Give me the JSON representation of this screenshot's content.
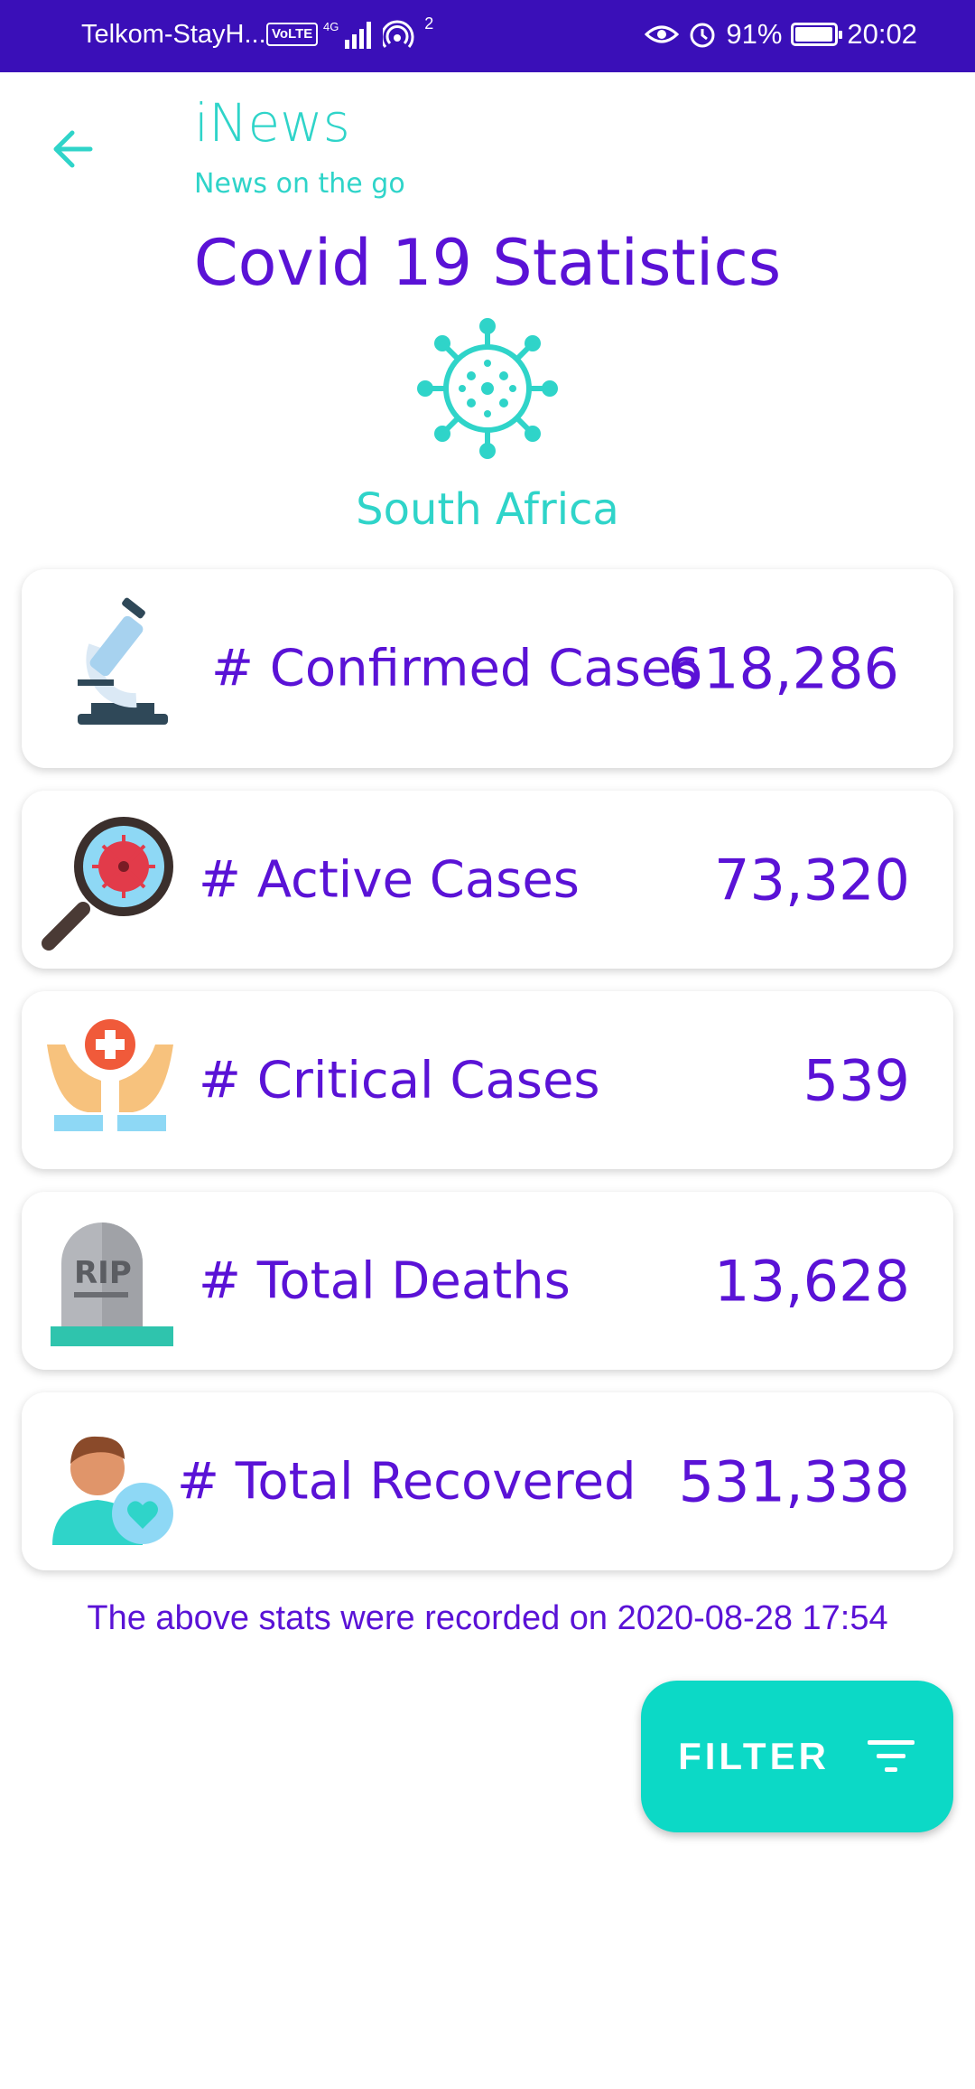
{
  "status_bar": {
    "carrier": "Telkom-StayH...",
    "volte": "VoLTE",
    "network": "4G",
    "hotspot_count": "2",
    "battery": "91%",
    "time": "20:02"
  },
  "header": {
    "app_name": "iNews",
    "tagline": "News on the go"
  },
  "page": {
    "title": "Covid 19 Statistics",
    "country": "South Africa"
  },
  "stats": [
    {
      "label": "# Confirmed Cases",
      "value": "618,286",
      "icon": "microscope-icon"
    },
    {
      "label": "# Active Cases",
      "value": "73,320",
      "icon": "magnifier-virus-icon"
    },
    {
      "label": "# Critical Cases",
      "value": "539",
      "icon": "hands-medical-icon"
    },
    {
      "label": "# Total Deaths",
      "value": "13,628",
      "icon": "tombstone-rip-icon"
    },
    {
      "label": "# Total Recovered",
      "value": "531,338",
      "icon": "recovered-person-icon"
    }
  ],
  "tombstone_text": "RIP",
  "footer_note": "The above stats were recorded on 2020-08-28 17:54",
  "filter_button": {
    "label": "FILTER"
  },
  "colors": {
    "status_bar": "#3a0fb8",
    "primary_purple": "#5a12d6",
    "accent_teal": "#2fd4c9",
    "fab_teal": "#0cd9c6"
  }
}
